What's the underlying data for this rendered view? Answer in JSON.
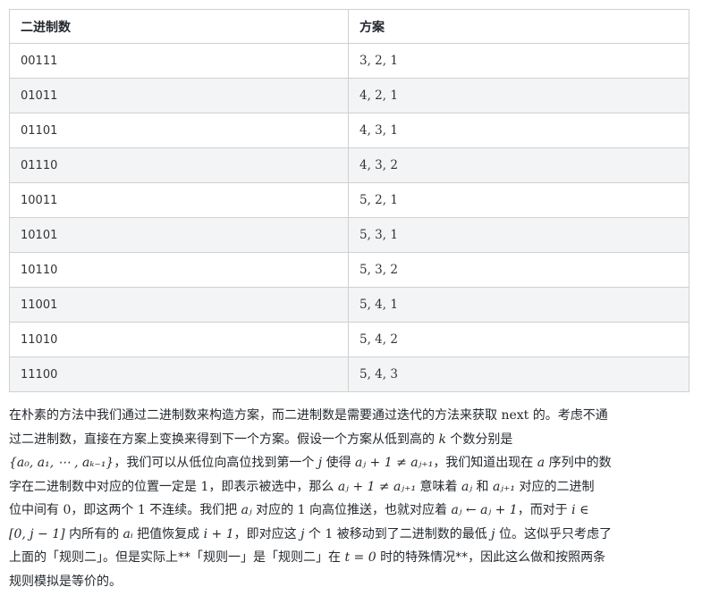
{
  "table": {
    "headers": [
      "二进制数",
      "方案"
    ],
    "rows": [
      [
        "00111",
        "3, 2, 1"
      ],
      [
        "01011",
        "4, 2, 1"
      ],
      [
        "01101",
        "4, 3, 1"
      ],
      [
        "01110",
        "4, 3, 2"
      ],
      [
        "10011",
        "5, 2, 1"
      ],
      [
        "10101",
        "5, 3, 1"
      ],
      [
        "10110",
        "5, 3, 2"
      ],
      [
        "11001",
        "5, 4, 1"
      ],
      [
        "11010",
        "5, 4, 2"
      ],
      [
        "11100",
        "5, 4, 3"
      ]
    ]
  },
  "paragraph": {
    "lines": [
      [
        {
          "t": "在朴素的方法中我们通过二进制数来构造方案，而二进制数是需要通过迭代的方法来获取 ",
          "s": "text"
        },
        {
          "t": "next",
          "s": "mr"
        },
        {
          "t": " 的。考虑不通",
          "s": "text"
        }
      ],
      [
        {
          "t": "过二进制数，直接在方案上变换来得到下一个方案。假设一个方案从低到高的 ",
          "s": "text"
        },
        {
          "t": "k",
          "s": "m"
        },
        {
          "t": " 个数分别是",
          "s": "text"
        }
      ],
      [
        {
          "t": "{a₀, a₁, ⋯ , aₖ₋₁}",
          "s": "m"
        },
        {
          "t": "，我们可以从低位向高位找到第一个 ",
          "s": "text"
        },
        {
          "t": "j",
          "s": "m"
        },
        {
          "t": " 使得 ",
          "s": "text"
        },
        {
          "t": "aⱼ + 1 ≠ aⱼ₊₁",
          "s": "m"
        },
        {
          "t": "，我们知道出现在 ",
          "s": "text"
        },
        {
          "t": "a",
          "s": "m"
        },
        {
          "t": " 序列中的数",
          "s": "text"
        }
      ],
      [
        {
          "t": "字在二进制数中对应的位置一定是 ",
          "s": "text"
        },
        {
          "t": "1",
          "s": "mr"
        },
        {
          "t": "，即表示被选中，那么 ",
          "s": "text"
        },
        {
          "t": "aⱼ + 1 ≠ aⱼ₊₁",
          "s": "m"
        },
        {
          "t": " 意味着 ",
          "s": "text"
        },
        {
          "t": "aⱼ",
          "s": "m"
        },
        {
          "t": " 和 ",
          "s": "text"
        },
        {
          "t": "aⱼ₊₁",
          "s": "m"
        },
        {
          "t": " 对应的二进制",
          "s": "text"
        }
      ],
      [
        {
          "t": "位中间有 ",
          "s": "text"
        },
        {
          "t": "0",
          "s": "mr"
        },
        {
          "t": "，即这两个 ",
          "s": "text"
        },
        {
          "t": "1",
          "s": "mr"
        },
        {
          "t": " 不连续。我们把 ",
          "s": "text"
        },
        {
          "t": "aⱼ",
          "s": "m"
        },
        {
          "t": " 对应的 ",
          "s": "text"
        },
        {
          "t": "1",
          "s": "mr"
        },
        {
          "t": " 向高位推送，也就对应着 ",
          "s": "text"
        },
        {
          "t": "aⱼ ← aⱼ + 1",
          "s": "m"
        },
        {
          "t": "，而对于 ",
          "s": "text"
        },
        {
          "t": "i ∈",
          "s": "m"
        }
      ],
      [
        {
          "t": "[0, j − 1]",
          "s": "m"
        },
        {
          "t": " 内所有的 ",
          "s": "text"
        },
        {
          "t": "aᵢ",
          "s": "m"
        },
        {
          "t": " 把值恢复成 ",
          "s": "text"
        },
        {
          "t": "i + 1",
          "s": "m"
        },
        {
          "t": "，即对应这 ",
          "s": "text"
        },
        {
          "t": "j",
          "s": "m"
        },
        {
          "t": " 个 ",
          "s": "text"
        },
        {
          "t": "1",
          "s": "mr"
        },
        {
          "t": " 被移动到了二进制数的最低 ",
          "s": "text"
        },
        {
          "t": "j",
          "s": "m"
        },
        {
          "t": " 位。这似乎只考虑了",
          "s": "text"
        }
      ],
      [
        {
          "t": "上面的「规则二」。但是实际上**「规则一」是「规则二」在 ",
          "s": "text"
        },
        {
          "t": "t = 0",
          "s": "m"
        },
        {
          "t": " 时的特殊情况**，因此这么做和按照两条",
          "s": "text"
        }
      ],
      [
        {
          "t": "规则模拟是等价的。",
          "s": "text"
        }
      ]
    ]
  }
}
